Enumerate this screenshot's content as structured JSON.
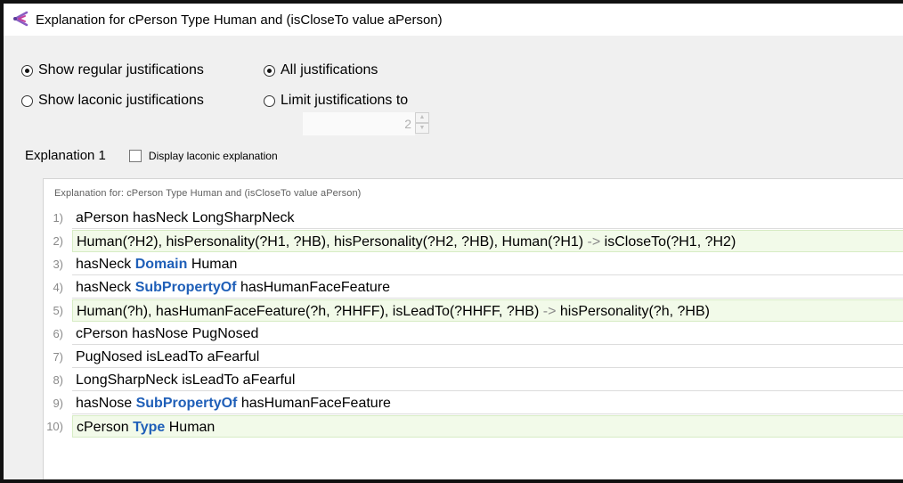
{
  "window": {
    "title": "Explanation for cPerson Type Human and (isCloseTo value aPerson)",
    "icon": "protege-icon"
  },
  "options": {
    "show_regular": "Show regular justifications",
    "show_laconic": "Show laconic justifications",
    "all_justifications": "All justifications",
    "limit_justifications": "Limit justifications to",
    "limit_value": "2",
    "show_regular_checked": true,
    "all_checked": true
  },
  "explanation": {
    "label": "Explanation 1",
    "laconic_checkbox_label": "Display laconic explanation",
    "laconic_checked": false,
    "header": "Explanation for: cPerson Type Human and (isCloseTo value aPerson)",
    "axioms": [
      {
        "num": "1)",
        "inferred": false,
        "parts": [
          {
            "t": "aPerson hasNeck LongSharpNeck",
            "k": "text"
          }
        ]
      },
      {
        "num": "2)",
        "inferred": true,
        "parts": [
          {
            "t": "Human(?H2), hisPersonality(?H1, ?HB), hisPersonality(?H2, ?HB), Human(?H1) ",
            "k": "text"
          },
          {
            "t": "->",
            "k": "arrow"
          },
          {
            "t": " isCloseTo(?H1, ?H2)",
            "k": "text"
          }
        ]
      },
      {
        "num": "3)",
        "inferred": false,
        "parts": [
          {
            "t": "hasNeck ",
            "k": "text"
          },
          {
            "t": "Domain",
            "k": "kw"
          },
          {
            "t": " Human",
            "k": "text"
          }
        ]
      },
      {
        "num": "4)",
        "inferred": false,
        "parts": [
          {
            "t": "hasNeck ",
            "k": "text"
          },
          {
            "t": "SubPropertyOf",
            "k": "kw"
          },
          {
            "t": " hasHumanFaceFeature",
            "k": "text"
          }
        ]
      },
      {
        "num": "5)",
        "inferred": true,
        "parts": [
          {
            "t": "Human(?h), hasHumanFaceFeature(?h, ?HHFF), isLeadTo(?HHFF, ?HB) ",
            "k": "text"
          },
          {
            "t": "->",
            "k": "arrow"
          },
          {
            "t": " hisPersonality(?h, ?HB)",
            "k": "text"
          }
        ]
      },
      {
        "num": "6)",
        "inferred": false,
        "parts": [
          {
            "t": "cPerson hasNose PugNosed",
            "k": "text"
          }
        ]
      },
      {
        "num": "7)",
        "inferred": false,
        "parts": [
          {
            "t": "PugNosed isLeadTo aFearful",
            "k": "text"
          }
        ]
      },
      {
        "num": "8)",
        "inferred": false,
        "parts": [
          {
            "t": "LongSharpNeck isLeadTo aFearful",
            "k": "text"
          }
        ]
      },
      {
        "num": "9)",
        "inferred": false,
        "parts": [
          {
            "t": "hasNose ",
            "k": "text"
          },
          {
            "t": "SubPropertyOf",
            "k": "kw"
          },
          {
            "t": " hasHumanFaceFeature",
            "k": "text"
          }
        ]
      },
      {
        "num": "10)",
        "inferred": true,
        "parts": [
          {
            "t": "cPerson ",
            "k": "text"
          },
          {
            "t": "Type",
            "k": "kw"
          },
          {
            "t": " Human",
            "k": "text"
          }
        ]
      }
    ]
  }
}
